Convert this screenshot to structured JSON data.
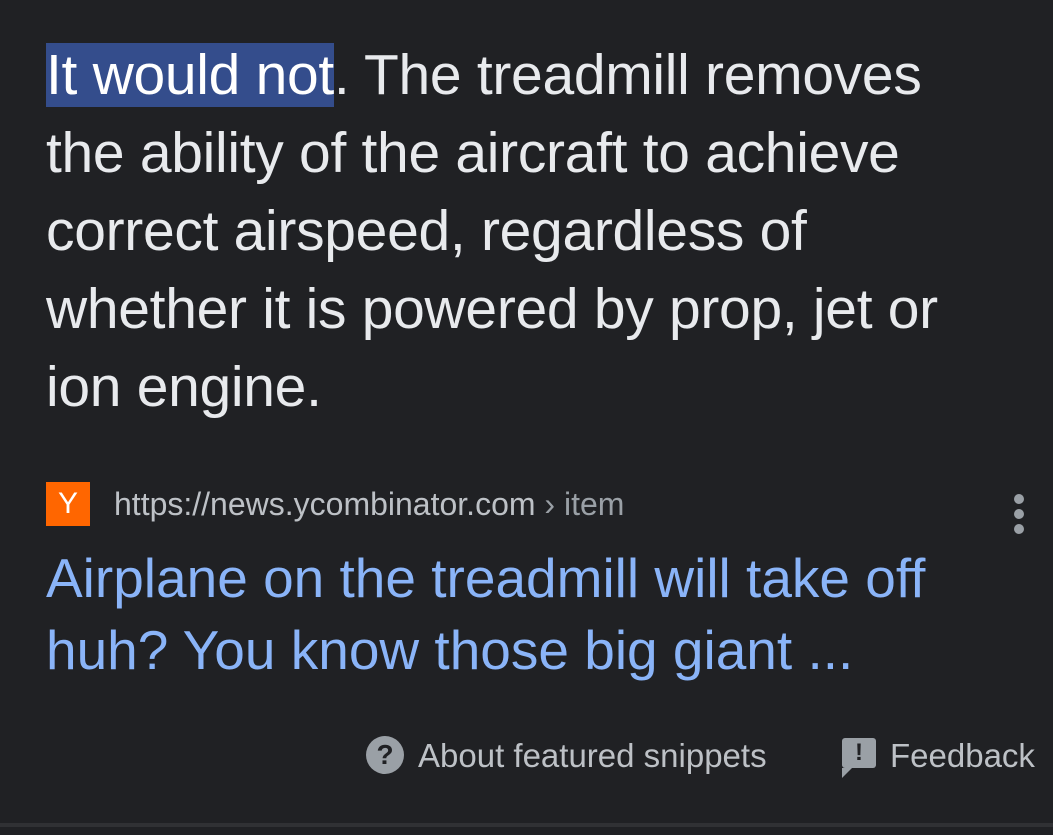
{
  "snippet": {
    "highlighted": "It would not",
    "rest_line1": ". The treadmill removes",
    "line2": "the ability of the aircraft to achieve",
    "line3": "correct airspeed, regardless of",
    "line4": "whether it is powered by prop, jet or",
    "line5": "ion engine."
  },
  "source": {
    "favicon_letter": "Y",
    "favicon_color": "#ff6600",
    "url": "https://news.ycombinator.com",
    "separator": "›",
    "path": "item",
    "more_icon": "more-vert-icon"
  },
  "result": {
    "title_line1": "Airplane on the treadmill will take off",
    "title_line2": "huh? You know those big giant ..."
  },
  "footer": {
    "about_icon": "help-circle-icon",
    "about_label": "About featured snippets",
    "feedback_icon": "feedback-icon",
    "feedback_label": "Feedback"
  },
  "colors": {
    "background": "#202124",
    "text": "#e8eaed",
    "link": "#8ab4f8",
    "highlight": "#344d8c"
  }
}
